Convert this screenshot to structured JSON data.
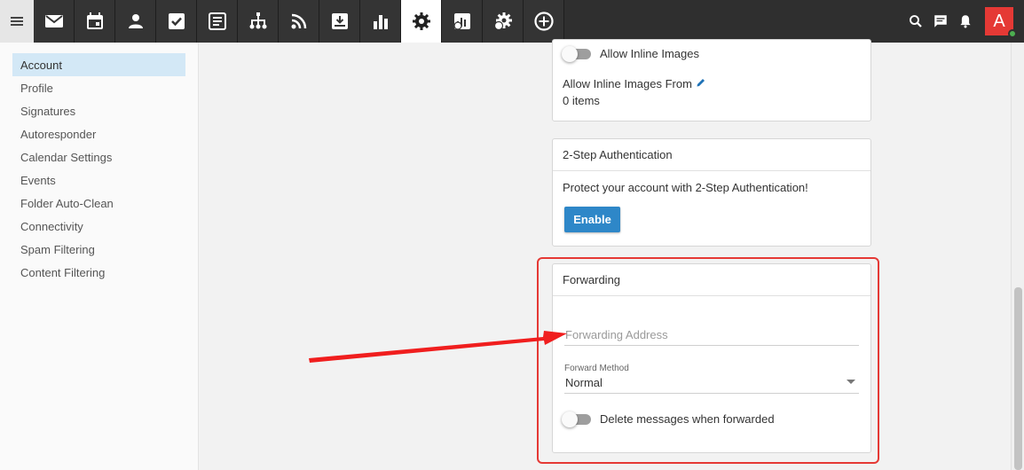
{
  "topbar": {
    "apps": [
      "mail-icon",
      "calendar-icon",
      "contacts-icon",
      "tasks-icon",
      "notes-icon",
      "sitemap-icon",
      "rss-icon",
      "inbox-download-icon",
      "reports-icon",
      "settings-icon",
      "domain-reports-icon",
      "domain-settings-icon",
      "add-circle-icon"
    ],
    "active_app": "settings-icon",
    "right_icons": [
      "search-icon",
      "chat-icon",
      "bell-icon"
    ],
    "avatar_letter": "A",
    "colors": {
      "bar": "#2f2f2f",
      "avatar": "#e53935",
      "status": "#4caf50"
    }
  },
  "sidebar": {
    "items": [
      {
        "label": "Account",
        "active": true
      },
      {
        "label": "Profile"
      },
      {
        "label": "Signatures"
      },
      {
        "label": "Autoresponder"
      },
      {
        "label": "Calendar Settings"
      },
      {
        "label": "Events"
      },
      {
        "label": "Folder Auto-Clean"
      },
      {
        "label": "Connectivity"
      },
      {
        "label": "Spam Filtering"
      },
      {
        "label": "Content Filtering"
      }
    ]
  },
  "images_card": {
    "allow_inline_label": "Allow Inline Images",
    "allow_from_label": "Allow Inline Images From",
    "allow_from_count": "0 items"
  },
  "twostep_card": {
    "title": "2-Step Authentication",
    "description": "Protect your account with 2-Step Authentication!",
    "enable_label": "Enable",
    "accent": "#2e87c8"
  },
  "forwarding_card": {
    "title": "Forwarding",
    "address_placeholder": "Forwarding Address",
    "method_label": "Forward Method",
    "method_value": "Normal",
    "delete_label": "Delete messages when forwarded",
    "highlight_color": "#e53935"
  }
}
